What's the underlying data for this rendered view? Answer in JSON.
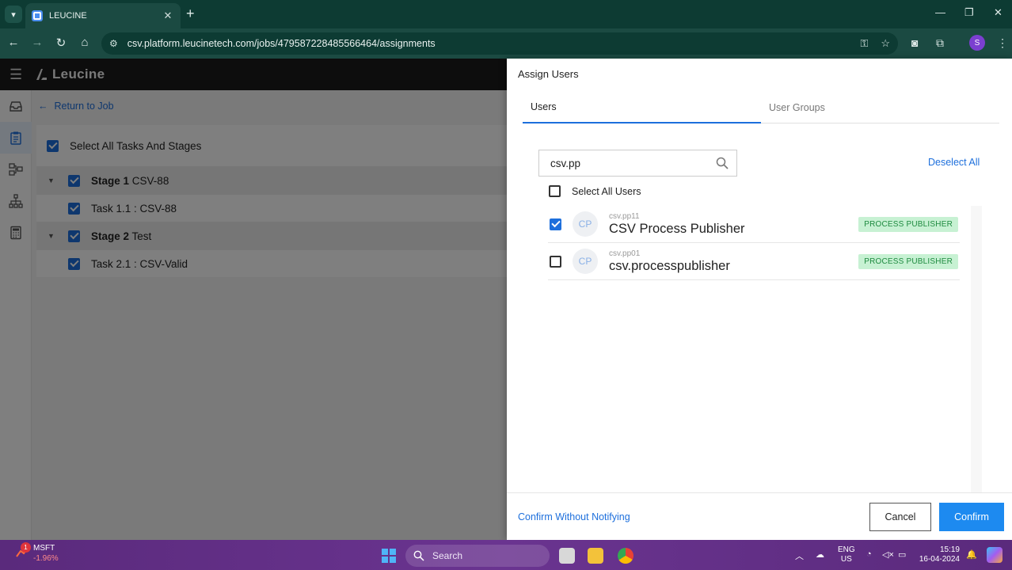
{
  "browser": {
    "tab_title": "LEUCINE",
    "url": "csv.platform.leucinetech.com/jobs/479587228485566464/assignments",
    "profile_initial": "S"
  },
  "app": {
    "logo_text": "Leucine",
    "return_link": "Return to Job",
    "select_all_tasks_label": "Select All Tasks And Stages",
    "stages": [
      {
        "prefix": "Stage 1",
        "name": "CSV-88",
        "task": "Task 1.1 : CSV-88"
      },
      {
        "prefix": "Stage 2",
        "name": "Test",
        "task": "Task 2.1 : CSV-Valid"
      }
    ]
  },
  "drawer": {
    "title": "Assign Users",
    "tabs": [
      "Users",
      "User Groups"
    ],
    "search_value": "csv.pp",
    "deselect_all": "Deselect All",
    "select_all_users": "Select All Users",
    "users": [
      {
        "initials": "CP",
        "id": "csv.pp11",
        "name": "CSV Process Publisher",
        "role": "PROCESS PUBLISHER",
        "checked": true
      },
      {
        "initials": "CP",
        "id": "csv.pp01",
        "name": "csv.processpublisher",
        "role": "PROCESS PUBLISHER",
        "checked": false
      }
    ],
    "confirm_without_notifying": "Confirm Without Notifying",
    "cancel": "Cancel",
    "confirm": "Confirm"
  },
  "taskbar": {
    "stock_name": "MSFT",
    "stock_change": "-1.96%",
    "stock_badge": "1",
    "search_label": "Search",
    "lang_line1": "ENG",
    "lang_line2": "US",
    "time": "15:19",
    "date": "16-04-2024"
  },
  "colors": {
    "accent": "#1d6fdc",
    "confirm_button": "#1d8af0",
    "role_badge_bg": "#c7f1d3",
    "role_badge_text": "#1d8a3f",
    "browser_chrome": "#1b4a42"
  }
}
